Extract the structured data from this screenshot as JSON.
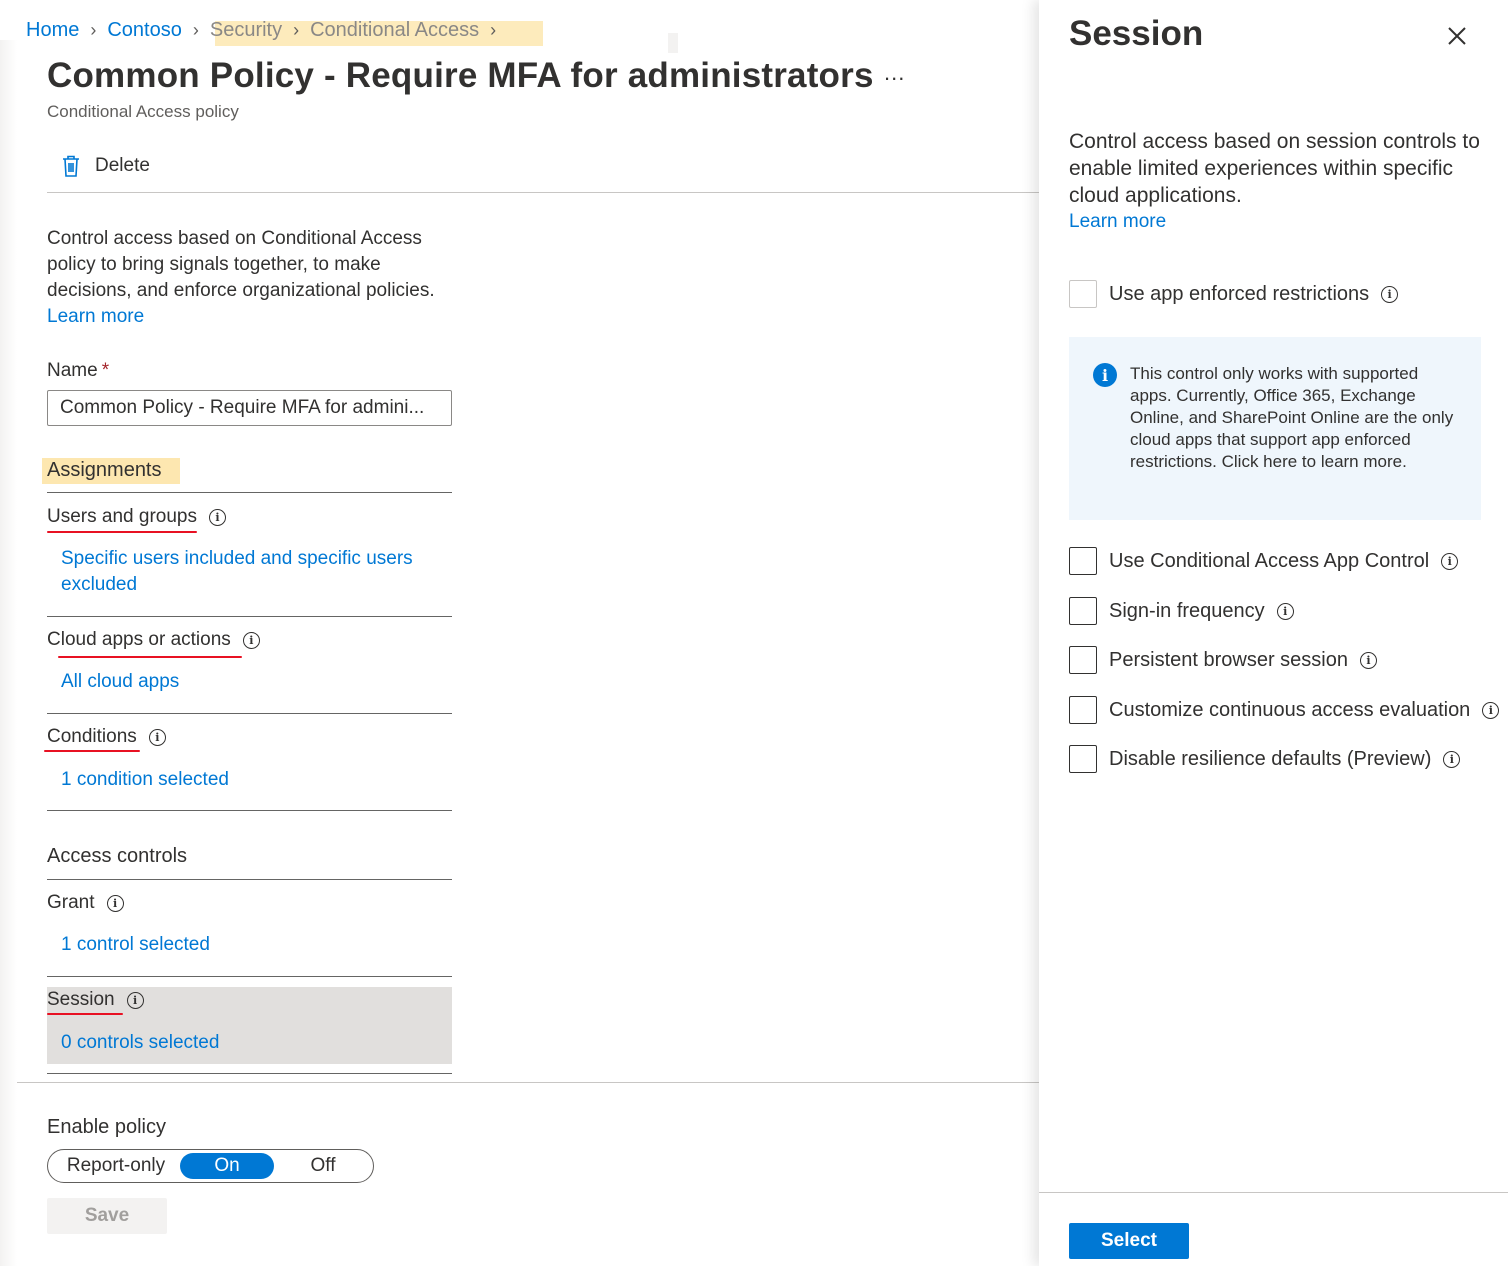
{
  "breadcrumb": {
    "items": [
      "Home",
      "Contoso",
      "Security",
      "Conditional Access"
    ]
  },
  "page": {
    "title": "Common Policy - Require MFA for administrators",
    "more": "...",
    "subtitle": "Conditional Access policy"
  },
  "toolbar": {
    "delete_label": "Delete"
  },
  "description": {
    "text": "Control access based on Conditional Access policy to bring signals together, to make decisions, and enforce organizational policies.",
    "learn_more": "Learn more"
  },
  "name_field": {
    "label": "Name",
    "required_marker": "*",
    "value": "Common Policy - Require MFA for admini..."
  },
  "assignments": {
    "heading": "Assignments",
    "users": {
      "label": "Users and groups",
      "value": "Specific users included and specific users excluded"
    },
    "cloud_apps": {
      "label": "Cloud apps or actions",
      "value": "All cloud apps"
    },
    "conditions": {
      "label": "Conditions",
      "value": "1 condition selected"
    }
  },
  "access_controls": {
    "heading": "Access controls",
    "grant": {
      "label": "Grant",
      "value": "1 control selected"
    },
    "session": {
      "label": "Session",
      "value": "0 controls selected"
    }
  },
  "enable_policy": {
    "label": "Enable policy",
    "options": [
      "Report-only",
      "On",
      "Off"
    ],
    "selected": "On"
  },
  "save_label": "Save",
  "panel": {
    "title": "Session",
    "description": "Control access based on session controls to enable limited experiences within specific cloud applications.",
    "learn_more": "Learn more",
    "app_enforced": "Use app enforced restrictions",
    "info_box": "This control only works with supported apps. Currently, Office 365, Exchange Online, and SharePoint Online are the only cloud apps that support app enforced restrictions. Click here to learn more.",
    "options": [
      "Use Conditional Access App Control",
      "Sign-in frequency",
      "Persistent browser session",
      "Customize continuous access evaluation",
      "Disable resilience defaults (Preview)"
    ],
    "select_label": "Select"
  },
  "colors": {
    "accent": "#0078d4",
    "highlight": "#fde7b0",
    "annotation_red": "#e81123"
  }
}
